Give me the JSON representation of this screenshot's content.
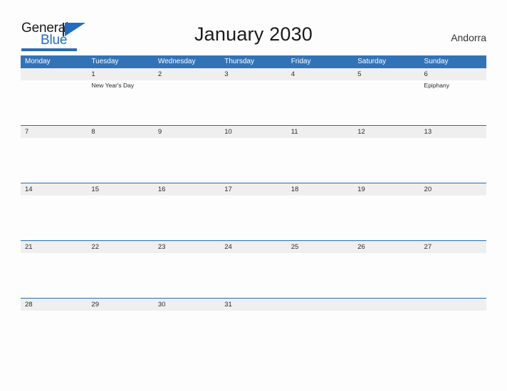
{
  "logo": {
    "word_top": "General",
    "word_bottom": "Blue",
    "triangle_color": "#1f6dc0",
    "underline_color": "#2b6cb0"
  },
  "header": {
    "title": "January 2030",
    "country": "Andorra"
  },
  "calendar": {
    "header_color": "#3273b8",
    "band_color": "#efefef",
    "divider_color": "#2b6cb0",
    "weekdays": [
      "Monday",
      "Tuesday",
      "Wednesday",
      "Thursday",
      "Friday",
      "Saturday",
      "Sunday"
    ],
    "weeks": [
      {
        "divider": false,
        "days": [
          {
            "num": "",
            "events": []
          },
          {
            "num": "1",
            "events": [
              "New Year's Day"
            ]
          },
          {
            "num": "2",
            "events": []
          },
          {
            "num": "3",
            "events": []
          },
          {
            "num": "4",
            "events": []
          },
          {
            "num": "5",
            "events": []
          },
          {
            "num": "6",
            "events": [
              "Epiphany"
            ]
          }
        ]
      },
      {
        "divider": true,
        "days": [
          {
            "num": "7",
            "events": []
          },
          {
            "num": "8",
            "events": []
          },
          {
            "num": "9",
            "events": []
          },
          {
            "num": "10",
            "events": []
          },
          {
            "num": "11",
            "events": []
          },
          {
            "num": "12",
            "events": []
          },
          {
            "num": "13",
            "events": []
          }
        ]
      },
      {
        "divider": true,
        "days": [
          {
            "num": "14",
            "events": []
          },
          {
            "num": "15",
            "events": []
          },
          {
            "num": "16",
            "events": []
          },
          {
            "num": "17",
            "events": []
          },
          {
            "num": "18",
            "events": []
          },
          {
            "num": "19",
            "events": []
          },
          {
            "num": "20",
            "events": []
          }
        ]
      },
      {
        "divider": true,
        "days": [
          {
            "num": "21",
            "events": []
          },
          {
            "num": "22",
            "events": []
          },
          {
            "num": "23",
            "events": []
          },
          {
            "num": "24",
            "events": []
          },
          {
            "num": "25",
            "events": []
          },
          {
            "num": "26",
            "events": []
          },
          {
            "num": "27",
            "events": []
          }
        ]
      },
      {
        "divider": true,
        "days": [
          {
            "num": "28",
            "events": []
          },
          {
            "num": "29",
            "events": []
          },
          {
            "num": "30",
            "events": []
          },
          {
            "num": "31",
            "events": []
          },
          {
            "num": "",
            "events": []
          },
          {
            "num": "",
            "events": []
          },
          {
            "num": "",
            "events": []
          }
        ]
      }
    ]
  }
}
